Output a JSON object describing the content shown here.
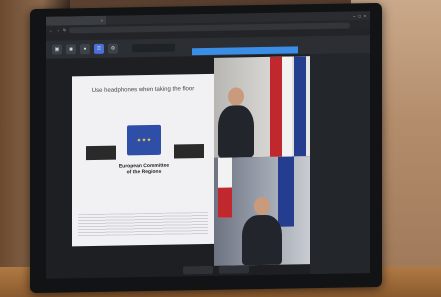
{
  "browser": {
    "tab_title": "",
    "url": "",
    "bookmarks": ""
  },
  "app": {
    "search_placeholder": ""
  },
  "slide": {
    "title": "Use headphones when taking the floor",
    "org_name_line1": "European Committee",
    "org_name_line2": "of the Regions"
  },
  "panel": {
    "items": [
      {
        "text": "",
        "time": ""
      },
      {
        "text": "",
        "time": ""
      },
      {
        "text": "",
        "time": ""
      },
      {
        "text": "",
        "time": ""
      },
      {
        "text": "",
        "time": ""
      },
      {
        "text": "",
        "time": ""
      }
    ]
  },
  "controls": {
    "left_label": "",
    "right_label": ""
  },
  "colors": {
    "accent": "#3a8ee6",
    "eu_blue": "#2f4ea8",
    "flag_red": "#c0282e"
  }
}
